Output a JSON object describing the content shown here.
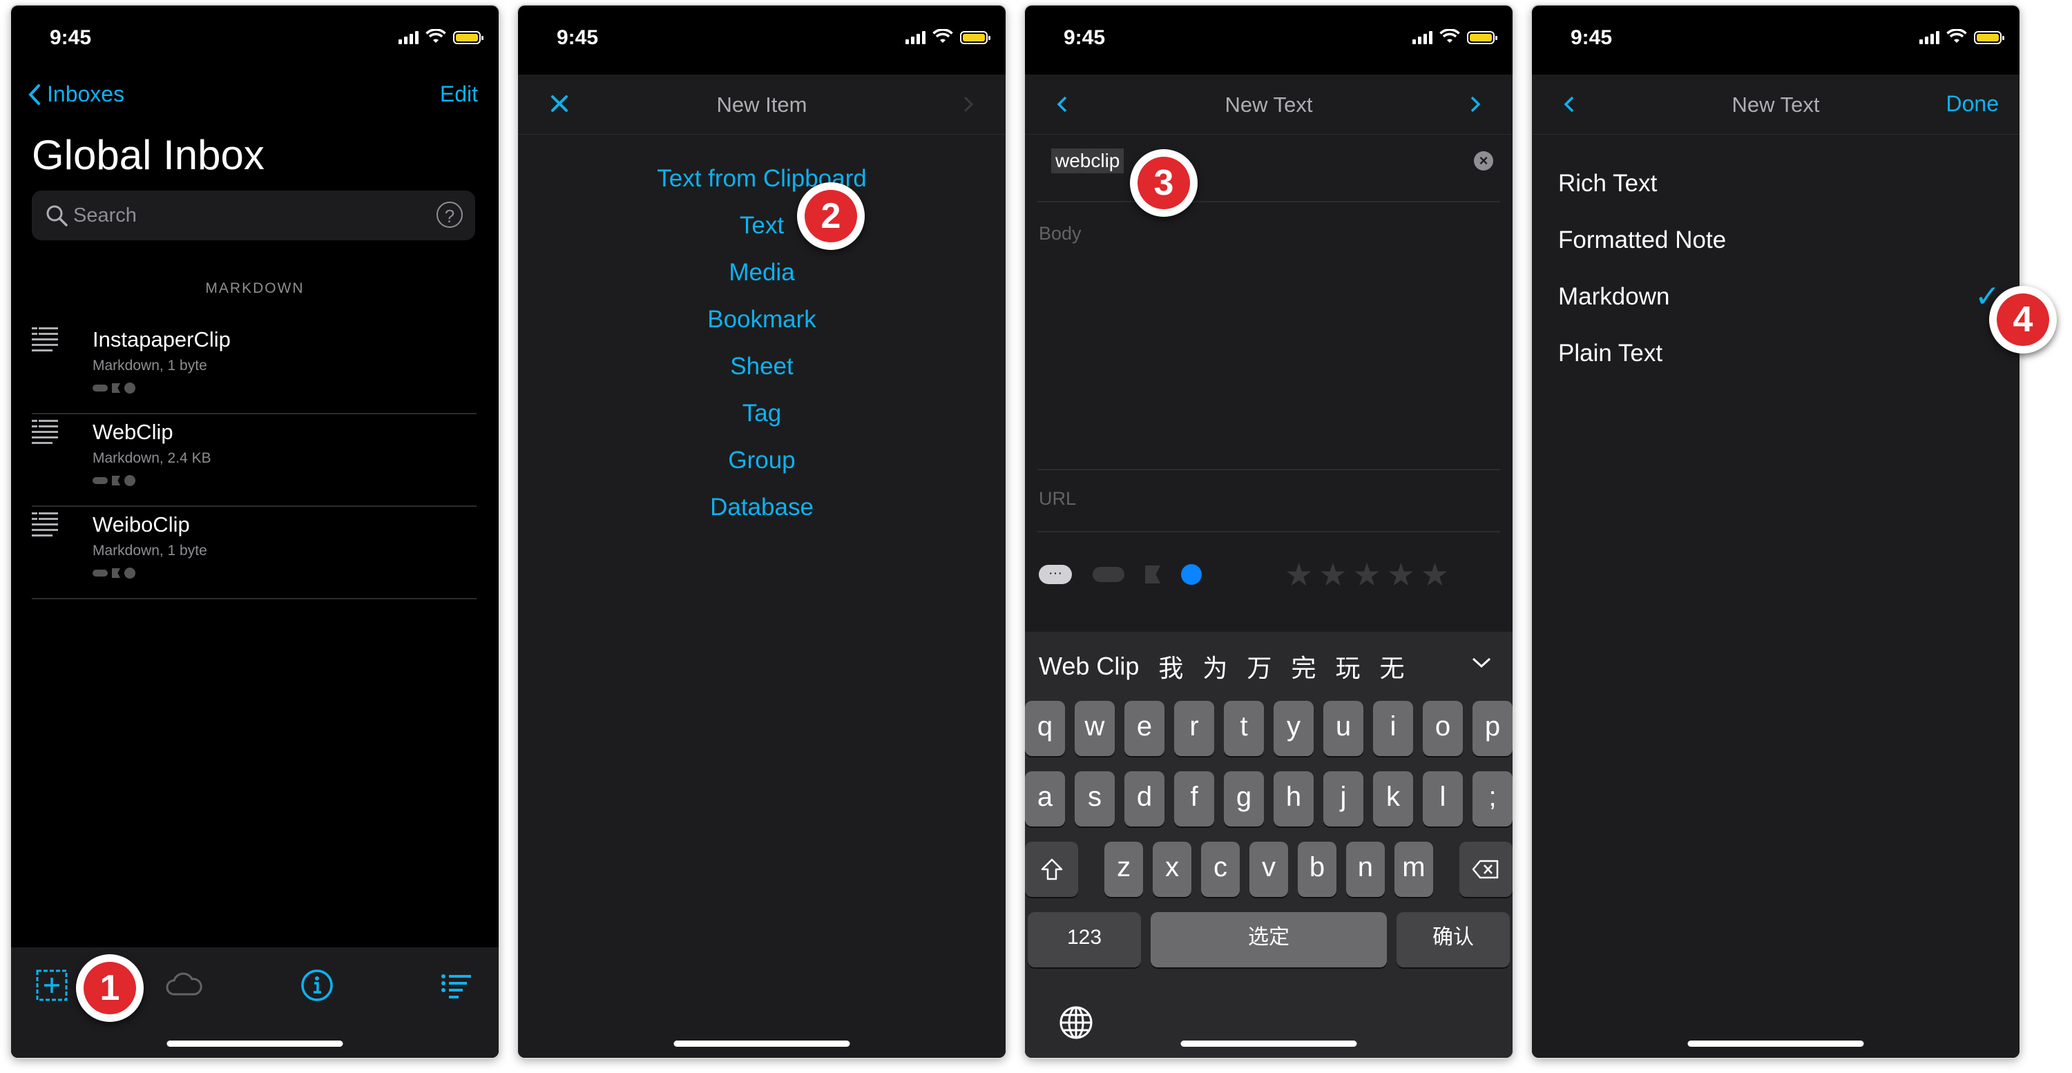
{
  "status": {
    "time": "9:45"
  },
  "phone1": {
    "back_label": "Inboxes",
    "edit_label": "Edit",
    "title": "Global Inbox",
    "search_placeholder": "Search",
    "section_header": "MARKDOWN",
    "items": [
      {
        "name": "InstapaperClip",
        "meta": "Markdown, 1 byte"
      },
      {
        "name": "WebClip",
        "meta": "Markdown, 2.4 KB"
      },
      {
        "name": "WeiboClip",
        "meta": "Markdown, 1 byte"
      }
    ],
    "badge": "1"
  },
  "phone2": {
    "title": "New Item",
    "menu": [
      "Text from Clipboard",
      "Text",
      "Media",
      "Bookmark",
      "Sheet",
      "Tag",
      "Group",
      "Database"
    ],
    "badge": "2"
  },
  "phone3": {
    "title": "New Text",
    "name_value": "webclip",
    "body_placeholder": "Body",
    "url_placeholder": "URL",
    "chip_label": "···",
    "candidates": [
      "Web Clip",
      "我",
      "为",
      "万",
      "完",
      "玩",
      "无"
    ],
    "keyboard": {
      "row1": [
        "q",
        "w",
        "e",
        "r",
        "t",
        "y",
        "u",
        "i",
        "o",
        "p"
      ],
      "row2": [
        "a",
        "s",
        "d",
        "f",
        "g",
        "h",
        "j",
        "k",
        "l",
        ";"
      ],
      "row3": [
        "z",
        "x",
        "c",
        "v",
        "b",
        "n",
        "m"
      ],
      "numbers_key": "123",
      "space_key": "选定",
      "return_key": "确认"
    },
    "badge": "3"
  },
  "phone4": {
    "title": "New Text",
    "done_label": "Done",
    "options": [
      "Rich Text",
      "Formatted Note",
      "Markdown",
      "Plain Text"
    ],
    "selected": "Markdown",
    "badge": "4"
  },
  "colors": {
    "accent": "#0db2f0",
    "badge": "#e0282d",
    "background": "#000000"
  }
}
